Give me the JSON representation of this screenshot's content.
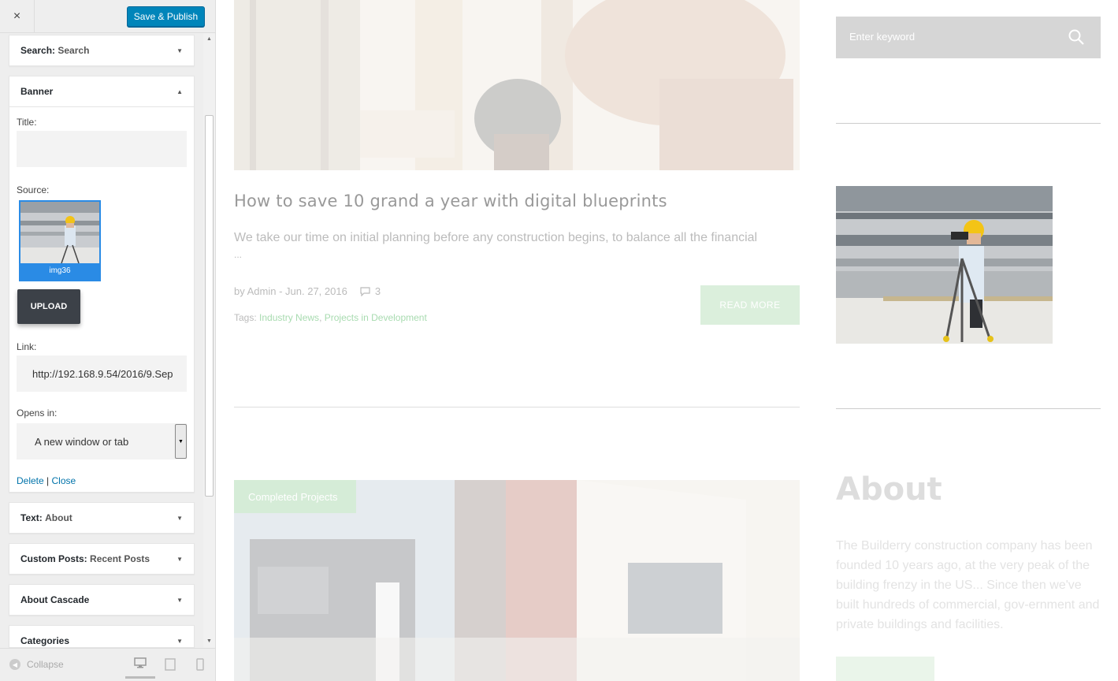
{
  "customizer": {
    "close_icon": "×",
    "save_label": "Save & Publish",
    "widgets": {
      "search": {
        "type": "Search:",
        "name": "Search"
      },
      "banner": {
        "name": "Banner",
        "title_label": "Title:",
        "title_value": "",
        "source_label": "Source:",
        "image_caption": "img36",
        "upload_label": "UPLOAD",
        "link_label": "Link:",
        "link_value": "http://192.168.9.54/2016/9.Sep",
        "opens_label": "Opens in:",
        "opens_value": "A new window or tab",
        "delete_label": "Delete",
        "separator": "|",
        "close_label": "Close"
      },
      "text": {
        "type": "Text:",
        "name": "About"
      },
      "custom_posts": {
        "type": "Custom Posts:",
        "name": "Recent Posts"
      },
      "about_cascade": {
        "name": "About Cascade"
      },
      "categories": {
        "name": "Categories"
      }
    },
    "footer": {
      "collapse_label": "Collapse"
    }
  },
  "preview": {
    "post": {
      "title": "How to save 10 grand a year with digital blueprints",
      "excerpt": "We take our time on initial planning before any construction begins, to balance all the financial",
      "ellipsis": "...",
      "meta_author": "by Admin - Jun. 27, 2016",
      "comments": "3",
      "tags_label": "Tags:",
      "tag1": "Industry News",
      "tag_sep": ",",
      "tag2": "Projects in Development",
      "read_more": "READ MORE"
    },
    "post2_badge": "Completed Projects",
    "sidebar": {
      "search_placeholder": "Enter keyword",
      "about_title": "About",
      "about_text": "The Builderry construction company has been founded 10 years ago, at the very peak of the building frenzy in the US... Since then we've built hundreds of commercial, gov-ernment and private buildings and facilities."
    }
  },
  "colors": {
    "accent": "#0085ba",
    "thumb_border": "#2a8be5",
    "upload_bg": "#3c4148",
    "green": "#a8dbb0"
  }
}
